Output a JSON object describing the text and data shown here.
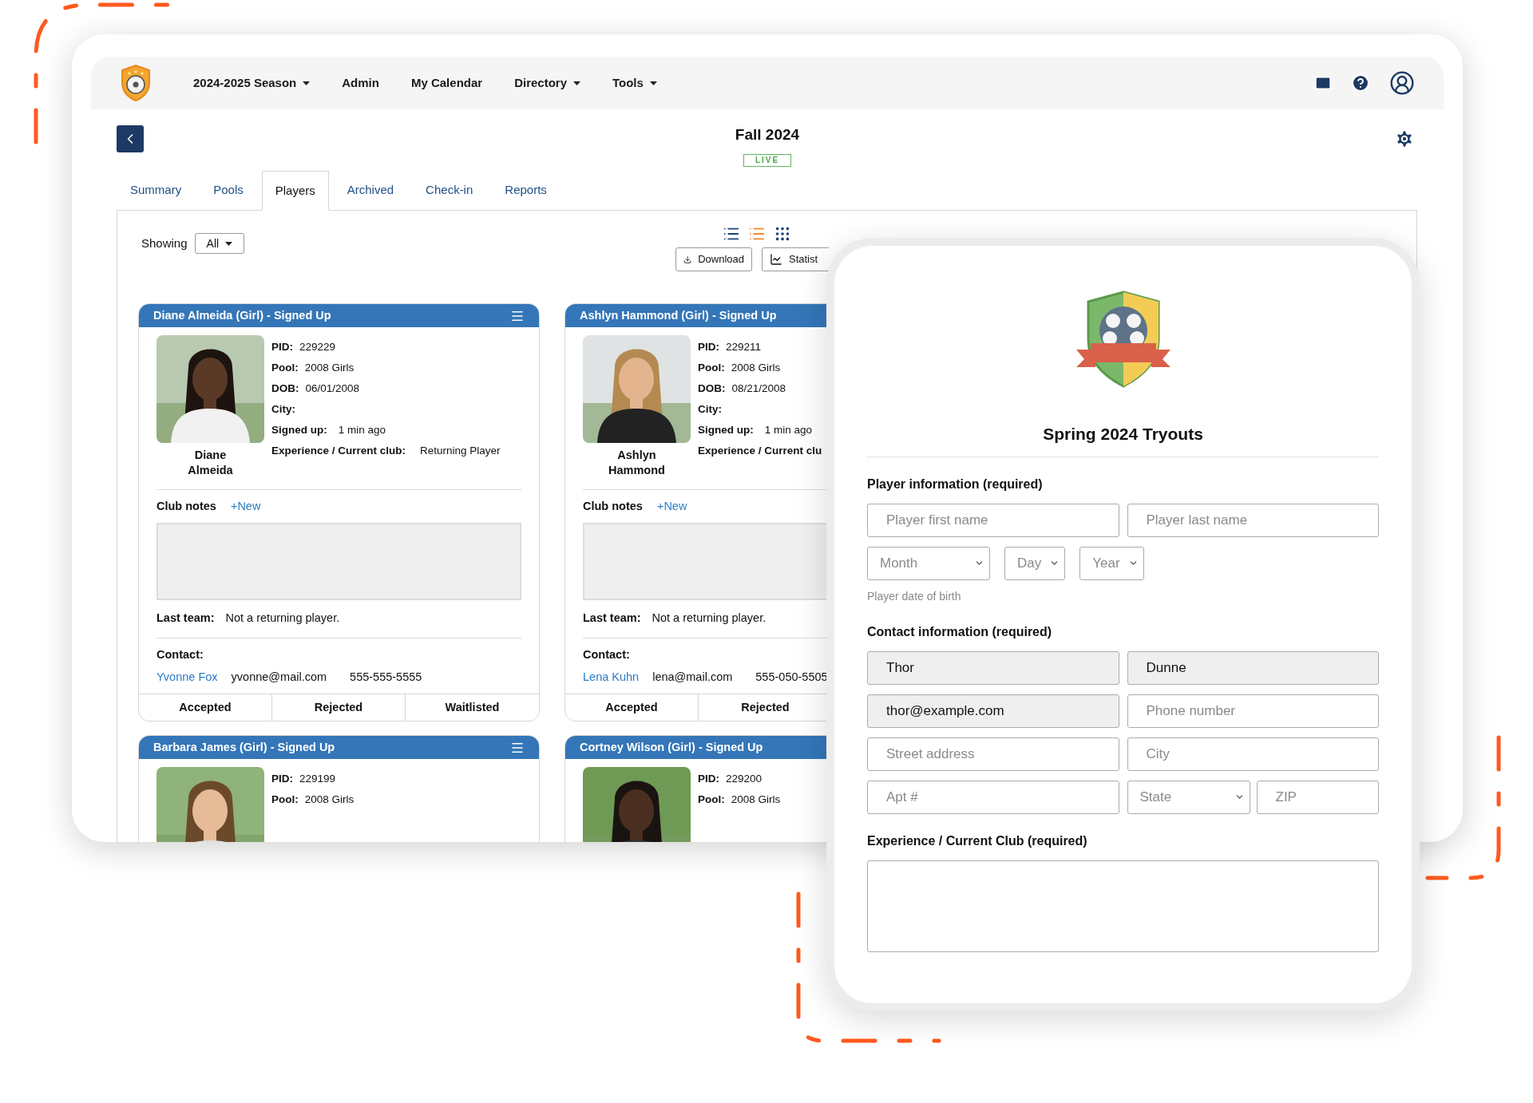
{
  "nav": {
    "items": [
      {
        "label": "2024-2025 Season",
        "has_menu": true
      },
      {
        "label": "Admin",
        "has_menu": false
      },
      {
        "label": "My Calendar",
        "has_menu": false
      },
      {
        "label": "Directory",
        "has_menu": true
      },
      {
        "label": "Tools",
        "has_menu": true
      }
    ]
  },
  "page": {
    "title": "Fall 2024",
    "status": "LIVE"
  },
  "tabs": [
    {
      "label": "Summary",
      "selected": false
    },
    {
      "label": "Pools",
      "selected": false
    },
    {
      "label": "Players",
      "selected": true
    },
    {
      "label": "Archived",
      "selected": false
    },
    {
      "label": "Check-in",
      "selected": false
    },
    {
      "label": "Reports",
      "selected": false
    }
  ],
  "filter": {
    "label": "Showing",
    "value": "All"
  },
  "view_modes": [
    {
      "kind": "list",
      "selected": false
    },
    {
      "kind": "detail",
      "selected": true
    },
    {
      "kind": "grid",
      "selected": false
    }
  ],
  "actions": [
    {
      "kind": "download",
      "label": "Download"
    },
    {
      "kind": "chart",
      "label": "Statist"
    }
  ],
  "cards": [
    {
      "header": "Diane Almeida (Girl) - Signed Up",
      "menu": true,
      "name": "Diane Almeida",
      "fields": [
        {
          "label": "PID:",
          "value": "229229"
        },
        {
          "label": "Pool:",
          "value": "2008 Girls"
        },
        {
          "label": "DOB:",
          "value": "06/01/2008"
        },
        {
          "label": "City:"
        },
        {
          "label": "Signed up:",
          "value": "1 min ago"
        },
        {
          "label": "Experience / Current club:",
          "value": "Returning Player"
        }
      ],
      "notes_label": "Club notes",
      "new_link": "+New",
      "last_team_label": "Last team:",
      "last_team": "Not a returning player.",
      "contact_label": "Contact:",
      "contact": {
        "name": "Yvonne Fox",
        "email": "yvonne@mail.com",
        "phone": "555-555-5555"
      },
      "statuses": [
        "Accepted",
        "Rejected",
        "Waitlisted"
      ]
    },
    {
      "header": "Ashlyn Hammond (Girl) - Signed Up",
      "name": "Ashlyn Hammond",
      "fields": [
        {
          "label": "PID:",
          "value": "229211"
        },
        {
          "label": "Pool:",
          "value": "2008 Girls"
        },
        {
          "label": "DOB:",
          "value": "08/21/2008"
        },
        {
          "label": "City:"
        },
        {
          "label": "Signed up:",
          "value": "1 min ago"
        },
        {
          "label": "Experience / Current clu"
        }
      ],
      "notes_label": "Club notes",
      "new_link": "+New",
      "last_team_label": "Last team:",
      "last_team": "Not a returning player.",
      "contact_label": "Contact:",
      "contact": {
        "name": "Lena Kuhn",
        "email": "lena@mail.com",
        "phone": "555-050-5505"
      },
      "statuses": [
        "Accepted",
        "Rejected"
      ]
    },
    {
      "header": "Barbara James (Girl) - Signed Up",
      "menu": true,
      "fields": [
        {
          "label": "PID:",
          "value": "229199"
        },
        {
          "label": "Pool:",
          "value": "2008 Girls"
        }
      ]
    },
    {
      "header": "Cortney Wilson (Girl) - Signed Up",
      "fields": [
        {
          "label": "PID:",
          "value": "229200"
        },
        {
          "label": "Pool:",
          "value": "2008 Girls"
        }
      ]
    }
  ],
  "form": {
    "title": "Spring 2024 Tryouts",
    "sections": [
      {
        "heading": "Player information (required)",
        "rows": [
          [
            [
              {
                "kind": "input",
                "placeholder": "Player first name"
              }
            ],
            [
              {
                "kind": "input",
                "placeholder": "Player last name"
              }
            ]
          ],
          [
            [
              {
                "kind": "select",
                "placeholder": "Month"
              },
              {
                "kind": "select",
                "placeholder": "Day"
              },
              {
                "kind": "select",
                "placeholder": "Year"
              }
            ]
          ]
        ],
        "hint": "Player date of birth"
      },
      {
        "heading": "Contact information (required)",
        "rows": [
          [
            [
              {
                "kind": "input",
                "value": "Thor"
              }
            ],
            [
              {
                "kind": "input",
                "value": "Dunne"
              }
            ]
          ],
          [
            [
              {
                "kind": "input",
                "value": "thor@example.com"
              }
            ],
            [
              {
                "kind": "input",
                "placeholder": "Phone number"
              }
            ]
          ],
          [
            [
              {
                "kind": "input",
                "placeholder": "Street address"
              }
            ],
            [
              {
                "kind": "input",
                "placeholder": "City"
              }
            ]
          ],
          [
            [
              {
                "kind": "input",
                "placeholder": "Apt #"
              }
            ],
            [
              {
                "kind": "select",
                "placeholder": "State"
              },
              {
                "kind": "input",
                "placeholder": "ZIP"
              }
            ]
          ]
        ]
      },
      {
        "heading": "Experience / Current Club (required)",
        "rows": [
          [
            [
              {
                "kind": "textarea"
              }
            ]
          ]
        ]
      }
    ]
  }
}
